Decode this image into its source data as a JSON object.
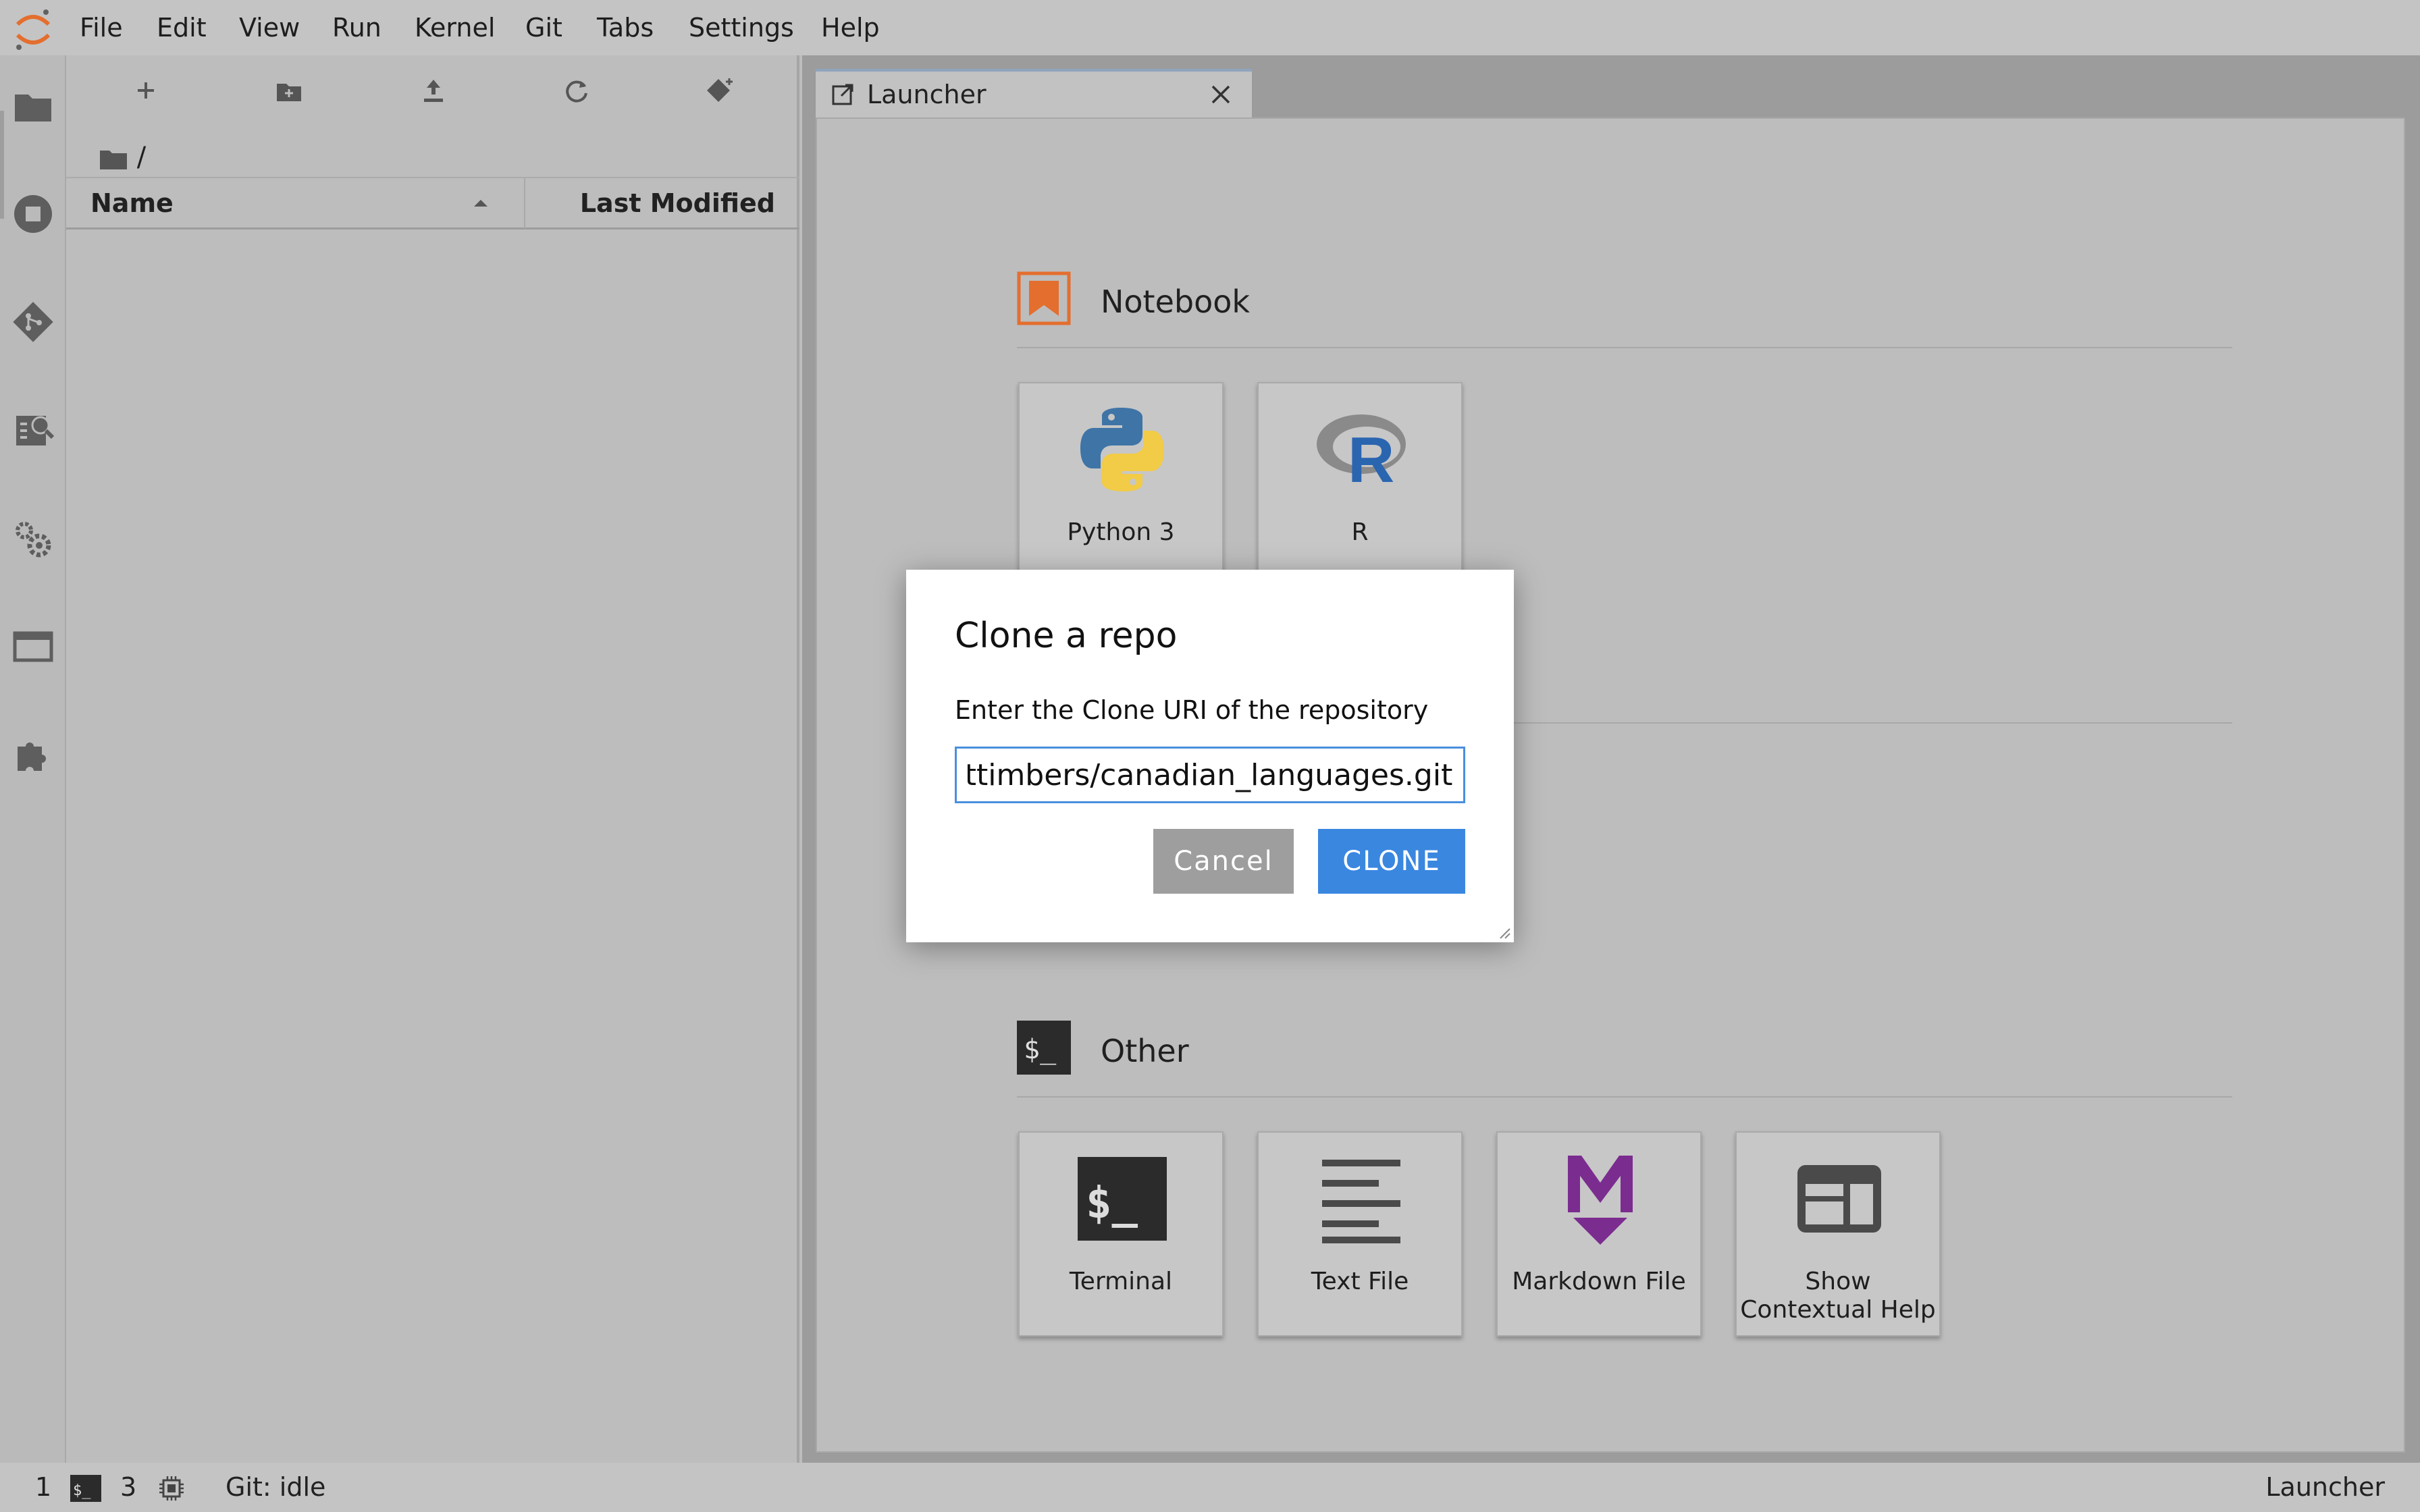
{
  "menu": {
    "items": [
      "File",
      "Edit",
      "View",
      "Run",
      "Kernel",
      "Git",
      "Tabs",
      "Settings",
      "Help"
    ]
  },
  "activity_bar": {
    "icons": [
      "folder-icon",
      "running-icon",
      "git-icon",
      "property-inspector-icon",
      "settings-icon",
      "tabs-icon",
      "extension-icon"
    ]
  },
  "file_browser": {
    "breadcrumb": "/",
    "columns": {
      "name": "Name",
      "last_modified": "Last Modified"
    }
  },
  "tab": {
    "label": "Launcher"
  },
  "launcher": {
    "notebook_title": "Notebook",
    "notebook_cards": [
      "Python 3",
      "R"
    ],
    "other_title": "Other",
    "other_cards": [
      "Terminal",
      "Text File",
      "Markdown File",
      "Show Contextual Help"
    ]
  },
  "dialog": {
    "title": "Clone a repo",
    "label": "Enter the Clone URI of the repository",
    "input_value": "n/ttimbers/canadian_languages.git",
    "cancel_label": "Cancel",
    "clone_label": "CLONE"
  },
  "statusbar": {
    "simple_count": "1",
    "terminal_count": "3",
    "git_status": "Git: idle",
    "active_label": "Launcher"
  },
  "colors": {
    "accent_blue": "#3a87e0",
    "jupyter_orange": "#e46e2e",
    "markdown_purple": "#7b2c8f"
  }
}
